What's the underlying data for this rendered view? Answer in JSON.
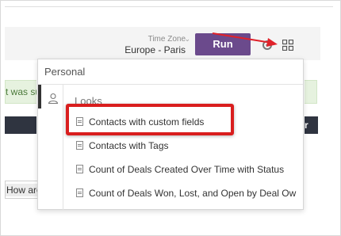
{
  "header": {
    "timezone_label": "Time Zone",
    "timezone_value": "Europe - Paris",
    "run_label": "Run"
  },
  "background": {
    "success_text": "t was su",
    "dark_button_text": "r",
    "question_text": "How are"
  },
  "dropdown": {
    "section_label": "Personal",
    "folder_title": "Looks",
    "items": [
      {
        "label": "Contacts with custom fields"
      },
      {
        "label": "Contacts with Tags"
      },
      {
        "label": "Count of Deals Created Over Time with Status"
      },
      {
        "label": "Count of Deals Won, Lost, and Open by Deal Ow"
      }
    ]
  },
  "annotation": {
    "highlight_color": "#d91e1e",
    "arrow_color": "#e0222a"
  },
  "colors": {
    "run_button": "#6b4a8c",
    "success_bg": "#e6f2df",
    "dark_bg": "#2f3440"
  }
}
